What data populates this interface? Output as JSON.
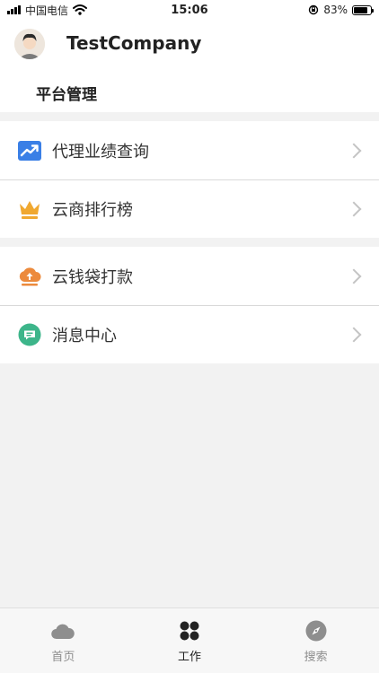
{
  "status_bar": {
    "carrier": "中国电信",
    "time": "15:06",
    "battery": "83%",
    "battery_level": 0.83
  },
  "header": {
    "company": "TestCompany",
    "section_title": "平台管理"
  },
  "menu_groups": [
    {
      "items": [
        {
          "label": "代理业绩查询",
          "icon": "trend-chart-icon",
          "color": "#3a7fe6"
        },
        {
          "label": "云商排行榜",
          "icon": "crown-icon",
          "color": "#f0a830"
        }
      ]
    },
    {
      "items": [
        {
          "label": "云钱袋打款",
          "icon": "cloud-upload-icon",
          "color": "#ec8a3c"
        },
        {
          "label": "消息中心",
          "icon": "message-icon",
          "color": "#3db58a"
        }
      ]
    }
  ],
  "tabs": [
    {
      "label": "首页",
      "icon": "cloud-icon",
      "active": false
    },
    {
      "label": "工作",
      "icon": "grid-icon",
      "active": true
    },
    {
      "label": "搜索",
      "icon": "compass-icon",
      "active": false
    }
  ]
}
